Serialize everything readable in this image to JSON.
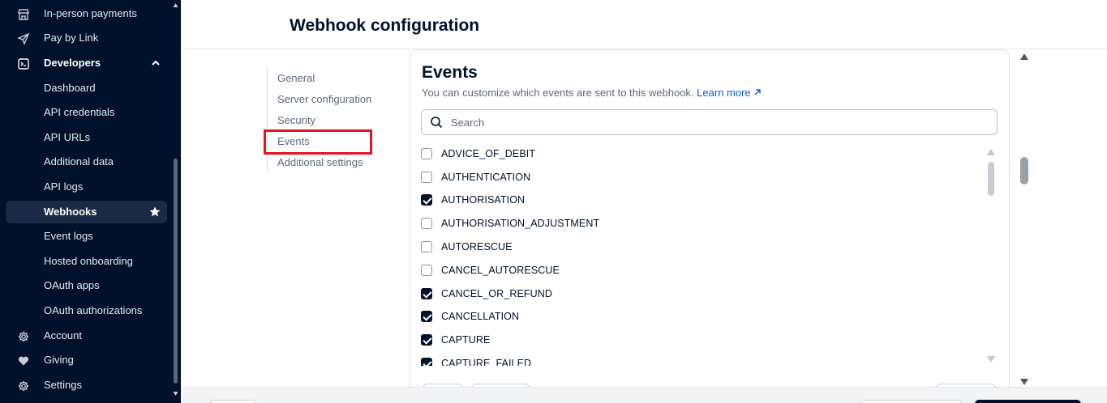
{
  "sidebar": {
    "items": [
      {
        "label": "In-person payments",
        "icon": "store-icon"
      },
      {
        "label": "Pay by Link",
        "icon": "paper-plane-icon"
      },
      {
        "label": "Developers",
        "icon": "terminal-icon"
      },
      {
        "label": "Dashboard"
      },
      {
        "label": "API credentials"
      },
      {
        "label": "API URLs"
      },
      {
        "label": "Additional data"
      },
      {
        "label": "API logs"
      },
      {
        "label": "Webhooks"
      },
      {
        "label": "Event logs"
      },
      {
        "label": "Hosted onboarding"
      },
      {
        "label": "OAuth apps"
      },
      {
        "label": "OAuth authorizations"
      },
      {
        "label": "Account",
        "icon": "gear-icon"
      },
      {
        "label": "Giving",
        "icon": "heart-hand-icon"
      },
      {
        "label": "Settings",
        "icon": "gear-icon"
      }
    ]
  },
  "header": {
    "title": "Webhook configuration"
  },
  "section_nav": {
    "items": [
      "General",
      "Server configuration",
      "Security",
      "Events",
      "Additional settings"
    ],
    "highlighted": "Events"
  },
  "events": {
    "title": "Events",
    "description": "You can customize which events are sent to this webhook.",
    "learn_more": "Learn more",
    "search_placeholder": "Search",
    "list": [
      {
        "name": "ADVICE_OF_DEBIT",
        "checked": false
      },
      {
        "name": "AUTHENTICATION",
        "checked": false
      },
      {
        "name": "AUTHORISATION",
        "checked": true
      },
      {
        "name": "AUTHORISATION_ADJUSTMENT",
        "checked": false
      },
      {
        "name": "AUTORESCUE",
        "checked": false
      },
      {
        "name": "CANCEL_AUTORESCUE",
        "checked": false
      },
      {
        "name": "CANCEL_OR_REFUND",
        "checked": true
      },
      {
        "name": "CANCELLATION",
        "checked": true
      },
      {
        "name": "CAPTURE",
        "checked": true
      },
      {
        "name": "CAPTURE_FAILED",
        "checked": true
      }
    ]
  },
  "colors": {
    "sidebar_bg": "#00112c",
    "accent_link": "#0a5cd7",
    "highlight": "#e0141e"
  }
}
